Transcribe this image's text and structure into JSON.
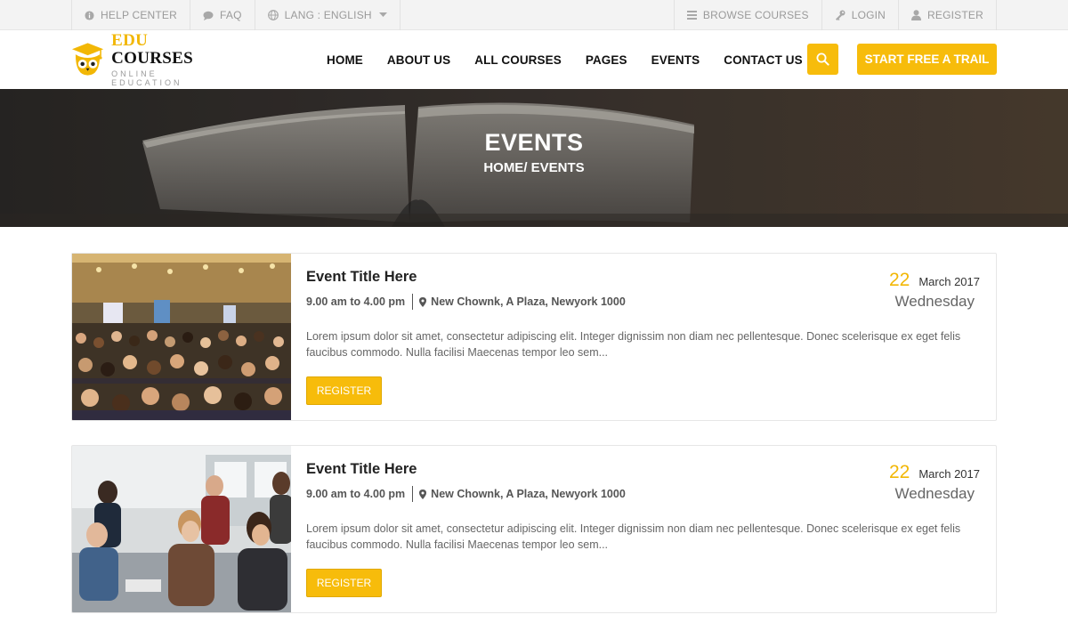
{
  "topbar": {
    "left": [
      {
        "label": "HELP CENTER",
        "icon": "info-icon"
      },
      {
        "label": "FAQ",
        "icon": "chat-icon"
      },
      {
        "label": "LANG : ENGLISH",
        "icon": "globe-icon"
      }
    ],
    "right": [
      {
        "label": "BROWSE COURSES",
        "icon": "list-icon"
      },
      {
        "label": "LOGIN",
        "icon": "key-icon"
      },
      {
        "label": "REGISTER",
        "icon": "user-icon"
      }
    ]
  },
  "header": {
    "logo": {
      "edu": "EDU",
      "courses": "COURSES",
      "subtitle": "ONLINE EDUCATION",
      "icon": "owl-graduation-icon"
    },
    "nav": [
      "HOME",
      "ABOUT US",
      "ALL COURSES",
      "PAGES",
      "EVENTS",
      "CONTACT US"
    ],
    "search_icon": "search-icon",
    "cta_label": "START FREE A TRAIL"
  },
  "banner": {
    "title": "EVENTS",
    "breadcrumb": "HOME/ EVENTS"
  },
  "events": [
    {
      "title": "Event Title Here",
      "time": "9.00 am to 4.00 pm",
      "location": "New Chownk, A Plaza, Newyork 1000",
      "description": "Lorem ipsum dolor sit amet, consectetur adipiscing elit. Integer dignissim non diam nec pellentesque. Donec scelerisque ex eget felis faucibus commodo. Nulla facilisi Maecenas tempor leo sem...",
      "button": "REGISTER",
      "day": "22",
      "month": "March 2017",
      "weekday": "Wednesday"
    },
    {
      "title": "Event Title Here",
      "time": "9.00 am to 4.00 pm",
      "location": "New Chownk, A Plaza, Newyork 1000",
      "description": "Lorem ipsum dolor sit amet, consectetur adipiscing elit. Integer dignissim non diam nec pellentesque. Donec scelerisque ex eget felis faucibus commodo. Nulla facilisi Maecenas tempor leo sem...",
      "button": "REGISTER",
      "day": "22",
      "month": "March 2017",
      "weekday": "Wednesday"
    }
  ],
  "colors": {
    "accent": "#f7bc0b",
    "topbar_bg": "#f3f3f3",
    "text_dark": "#222222",
    "text_muted": "#666666"
  }
}
